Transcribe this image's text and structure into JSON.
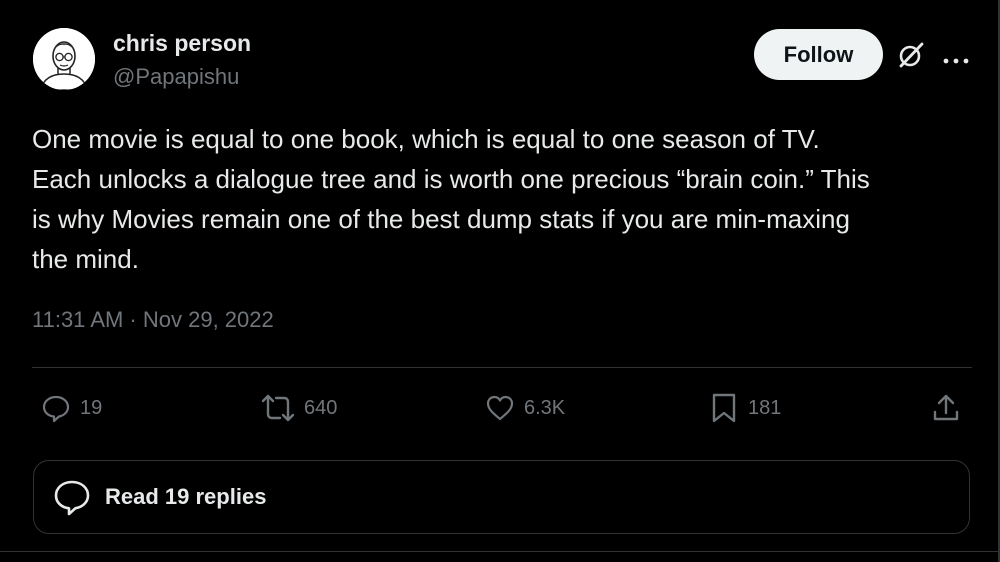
{
  "author": {
    "display_name": "chris person",
    "handle": "@Papapishu"
  },
  "header": {
    "follow_label": "Follow"
  },
  "tweet": {
    "lines": [
      "One movie is equal to one book, which is equal to one season of TV.",
      "Each unlocks a dialogue tree and is worth one precious “brain coin.” This",
      "is why Movies remain one of the best dump stats if you are min-maxing",
      "the mind."
    ],
    "timestamp": "11:31 AM · Nov 29, 2022"
  },
  "actions": {
    "replies": "19",
    "reposts": "640",
    "likes": "6.3K",
    "bookmarks": "181"
  },
  "read_replies": {
    "label": "Read 19 replies"
  },
  "colors": {
    "background": "#000000",
    "text_primary": "#e7e9ea",
    "text_secondary": "#71767b",
    "border": "#2f3336",
    "follow_bg": "#eff3f4"
  },
  "icons": [
    "grok-icon",
    "more-icon",
    "reply-icon",
    "repost-icon",
    "like-icon",
    "bookmark-icon",
    "share-icon",
    "read-replies-icon"
  ]
}
